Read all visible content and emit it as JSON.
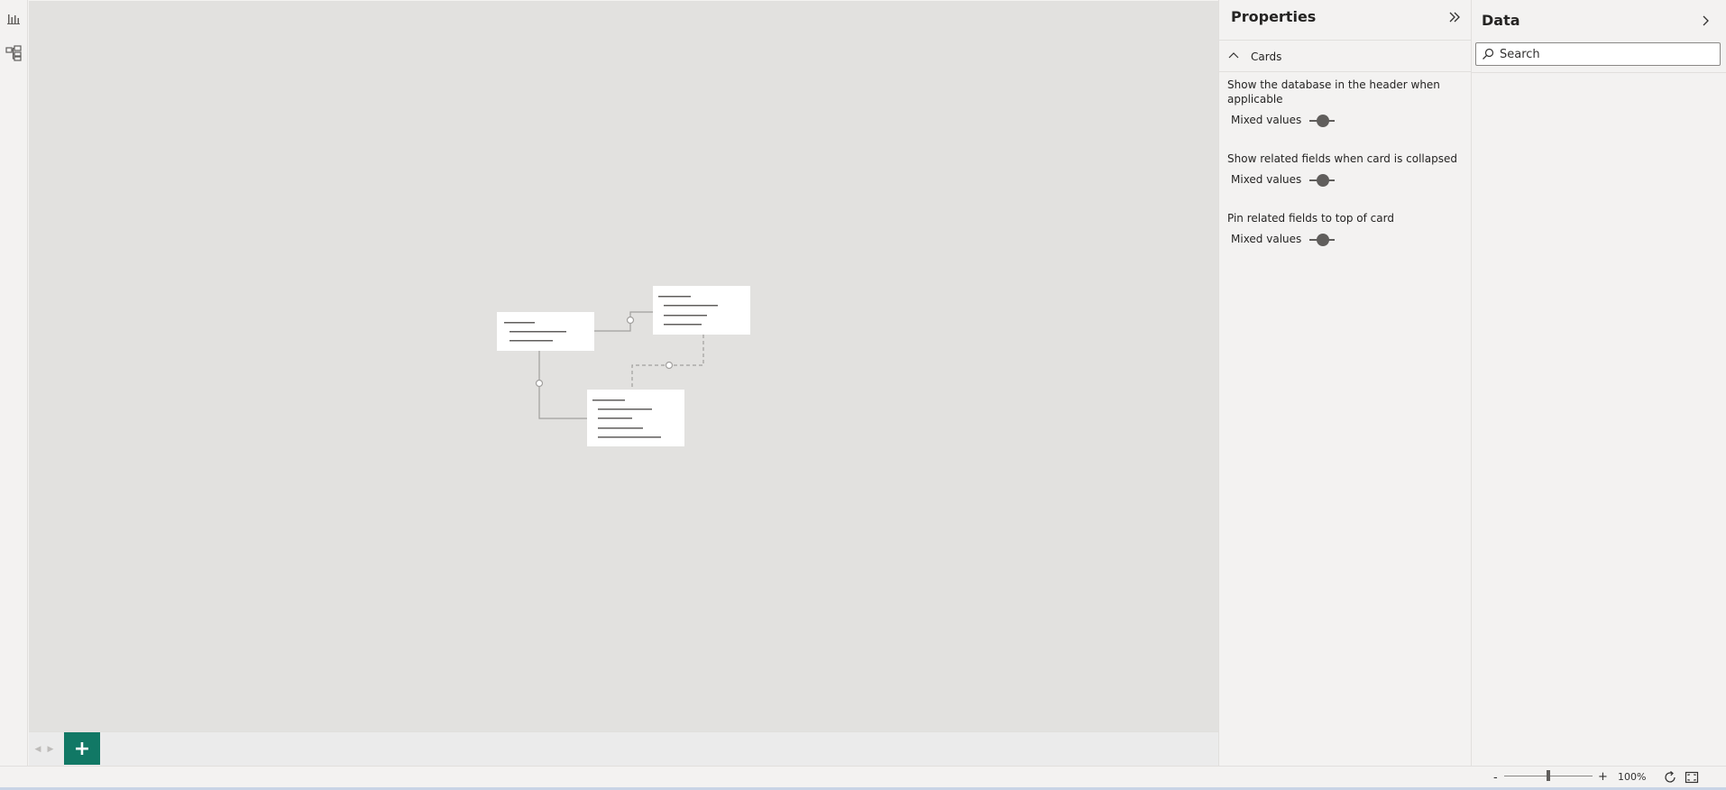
{
  "rail": {
    "report_view_icon": "bar-chart-icon",
    "model_view_icon": "model-view-icon"
  },
  "properties": {
    "title": "Properties",
    "collapse_icon": "double-chevron-right-icon",
    "section": {
      "label": "Cards",
      "chevron_icon": "chevron-up-icon"
    },
    "settings": [
      {
        "label": "Show the database in the header when applicable",
        "value": "Mixed values"
      },
      {
        "label": "Show related fields when card is collapsed",
        "value": "Mixed values"
      },
      {
        "label": "Pin related fields to top of card",
        "value": "Mixed values"
      }
    ]
  },
  "data": {
    "title": "Data",
    "expand_icon": "chevron-right-icon",
    "search_placeholder": "Search",
    "search_value": ""
  },
  "pages": {
    "add_label": "+",
    "prev_icon": "triangle-left-icon",
    "next_icon": "triangle-right-icon"
  },
  "status": {
    "zoom_minus": "-",
    "zoom_plus": "+",
    "zoom_level": "100%",
    "reset_icon": "reset-zoom-icon",
    "fit_icon": "fit-to-screen-icon"
  },
  "colors": {
    "accent": "#117865",
    "canvas": "#e2e1df",
    "pane": "#f3f2f1"
  }
}
